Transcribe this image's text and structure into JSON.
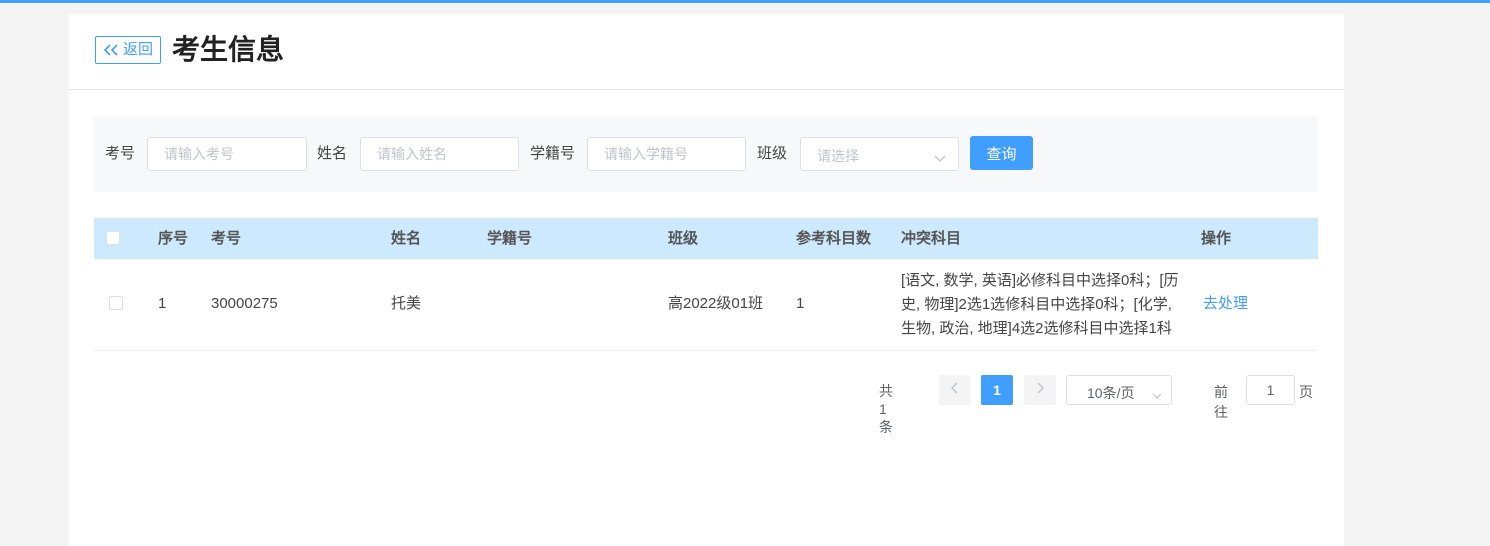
{
  "header": {
    "back_label": "返回",
    "title": "考生信息"
  },
  "filters": {
    "exam_no_label": "考号",
    "exam_no_placeholder": "请输入考号",
    "name_label": "姓名",
    "name_placeholder": "请输入姓名",
    "student_id_label": "学籍号",
    "student_id_placeholder": "请输入学籍号",
    "class_label": "班级",
    "class_placeholder": "请选择",
    "query_label": "查询"
  },
  "table": {
    "columns": [
      "序号",
      "考号",
      "姓名",
      "学籍号",
      "班级",
      "参考科目数",
      "冲突科目",
      "操作"
    ],
    "rows": [
      {
        "index": "1",
        "exam_no": "30000275",
        "name": "托美",
        "student_id": "",
        "class": "高2022级01班",
        "subject_count": "1",
        "conflict": "[语文, 数学, 英语]必修科目中选择0科；[历史, 物理]2选1选修科目中选择0科；[化学, 生物, 政治, 地理]4选2选修科目中选择1科",
        "action": "去处理"
      }
    ]
  },
  "pagination": {
    "total": "共 1 条",
    "current_page": "1",
    "page_size": "10条/页",
    "goto_label": "前往",
    "goto_value": "1",
    "page_suffix": "页"
  },
  "colors": {
    "accent": "#409eff",
    "header_row": "#cde9fd"
  }
}
